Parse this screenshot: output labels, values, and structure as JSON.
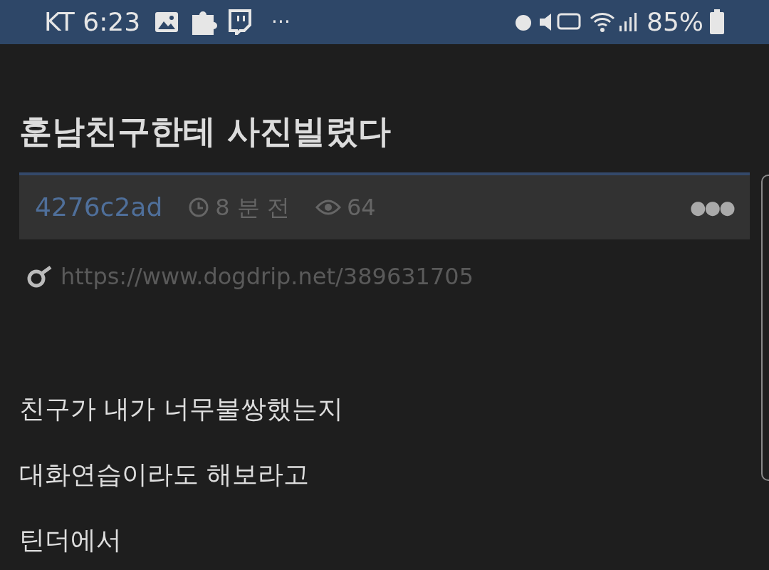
{
  "status_bar": {
    "carrier_time": "KT 6:23",
    "more": "···",
    "battery": "85%"
  },
  "post": {
    "title": "훈남친구한테 사진빌렸다",
    "author": "4276c2ad",
    "time": "8 분 전",
    "views": "64",
    "menu": "●●●",
    "link": "https://www.dogdrip.net/389631705",
    "lines": [
      "친구가 내가 너무불쌍했는지",
      "대화연습이라도 해보라고",
      "틴더에서"
    ]
  }
}
